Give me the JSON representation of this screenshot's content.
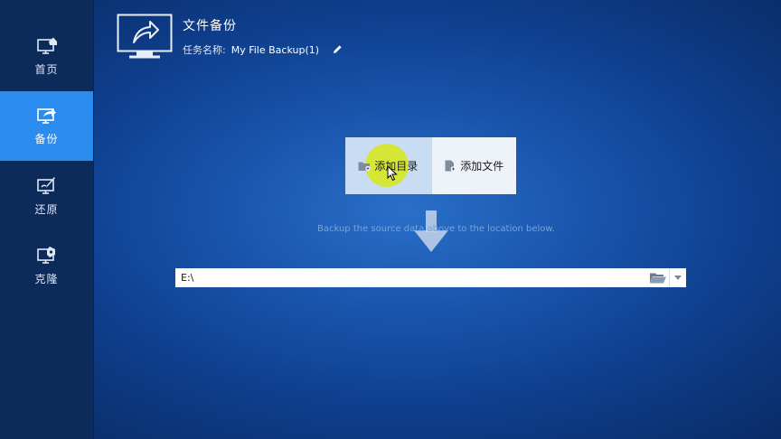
{
  "sidebar": {
    "items": [
      {
        "label": "首页",
        "icon": "home-monitor-icon",
        "active": false
      },
      {
        "label": "备份",
        "icon": "backup-monitor-icon",
        "active": true
      },
      {
        "label": "还原",
        "icon": "restore-monitor-icon",
        "active": false
      },
      {
        "label": "克隆",
        "icon": "clone-monitor-icon",
        "active": false
      }
    ]
  },
  "header": {
    "title": "文件备份",
    "task_label": "任务名称:",
    "task_name": "My File Backup(1)"
  },
  "source": {
    "add_directory_label": "添加目录",
    "add_file_label": "添加文件"
  },
  "hint": "Backup the source data above to the location below.",
  "destination": {
    "path": "E:\\"
  },
  "colors": {
    "background": "#1a56ae",
    "sidebar": "#0c2a5a",
    "active_nav": "#2b8cf0",
    "highlight": "#d8e814"
  }
}
